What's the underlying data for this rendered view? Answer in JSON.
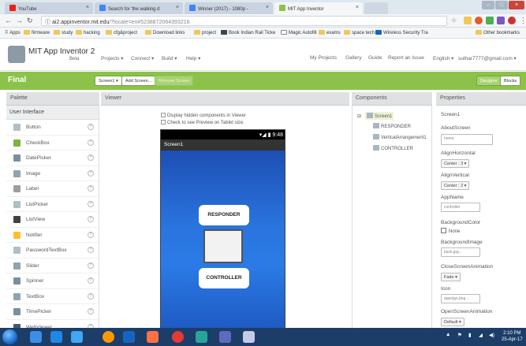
{
  "browser": {
    "tabs": [
      {
        "title": "YouTube",
        "color": "#e62117"
      },
      {
        "title": "Search for 'the walking d",
        "color": "#4285f4"
      },
      {
        "title": "Winner (2017) - 1080p - ",
        "color": "#4285f4"
      },
      {
        "title": "MIT App Inventor",
        "color": "#8bc34a"
      }
    ],
    "url_host": "ai2.appinventor.mit.edu",
    "url_path": "/?locale=en#5238872064393216",
    "bookmarks": [
      "Apps",
      "firmware",
      "study",
      "hacking",
      "cfg&project",
      "Download links",
      "project",
      "Book Indian Rail Ticke",
      "Magic Autofill",
      "exams",
      "space tech",
      "Wireless Security Tra"
    ],
    "other_bookmarks": "Other bookmarks"
  },
  "header": {
    "brand": "MIT App Inventor 2",
    "beta": "Beta",
    "menus": [
      "Projects ▾",
      "Connect ▾",
      "Build ▾",
      "Help ▾"
    ],
    "links": [
      "My Projects",
      "Gallery",
      "Guide",
      "Report an Issue",
      "English ▾",
      "suthar7777@gmail.com ▾"
    ]
  },
  "project": {
    "name": "Final",
    "screen_select": "Screen1 ▾",
    "add_screen": "Add Screen...",
    "remove_screen": "Remove Screen",
    "designer": "Designer",
    "blocks": "Blocks"
  },
  "palette": {
    "title": "Palette",
    "category": "User Interface",
    "items": [
      {
        "label": "Button",
        "icon": "button-icon"
      },
      {
        "label": "CheckBox",
        "icon": "checkbox-icon"
      },
      {
        "label": "DatePicker",
        "icon": "datepicker-icon"
      },
      {
        "label": "Image",
        "icon": "image-icon"
      },
      {
        "label": "Label",
        "icon": "label-icon"
      },
      {
        "label": "ListPicker",
        "icon": "listpicker-icon"
      },
      {
        "label": "ListView",
        "icon": "listview-icon"
      },
      {
        "label": "Notifier",
        "icon": "notifier-icon"
      },
      {
        "label": "PasswordTextBox",
        "icon": "password-icon"
      },
      {
        "label": "Slider",
        "icon": "slider-icon"
      },
      {
        "label": "Spinner",
        "icon": "spinner-icon"
      },
      {
        "label": "TextBox",
        "icon": "textbox-icon"
      },
      {
        "label": "TimePicker",
        "icon": "timepicker-icon"
      },
      {
        "label": "WebViewer",
        "icon": "webviewer-icon"
      }
    ],
    "help": "?"
  },
  "viewer": {
    "title": "Viewer",
    "hidden_components": "Display hidden components in Viewer",
    "tablet_preview": "Check to see Preview on Tablet size.",
    "status_time": "9:48",
    "screen_title": "Screen1",
    "button_top": "RESPONDER",
    "button_bottom": "CONTROLLER"
  },
  "components": {
    "title": "Components",
    "tree": [
      "Screen1",
      "RESPONDER",
      "VerticalArrangement1",
      "CONTROLLER"
    ]
  },
  "properties": {
    "title": "Properties",
    "screen": "Screen1",
    "about_label": "AboutScreen",
    "about_value": "home",
    "align_h_label": "AlignHorizontal",
    "align_h_value": "Center : 3 ▾",
    "align_v_label": "AlignVertical",
    "align_v_value": "Center : 2 ▾",
    "appname_label": "AppName",
    "appname_value": "controller",
    "bgcolor_label": "BackgroundColor",
    "bgcolor_value": "None",
    "bgimage_label": "BackgroundImage",
    "bgimage_value": "back.jpg...",
    "close_anim_label": "CloseScreenAnimation",
    "close_anim_value": "Fade ▾",
    "icon_label": "Icon",
    "icon_value": "appsign.png...",
    "open_anim_label": "OpenScreenAnimation",
    "open_anim_value": "Default ▾"
  },
  "taskbar": {
    "time": "2:10 PM",
    "date": "25-Apr-17"
  }
}
